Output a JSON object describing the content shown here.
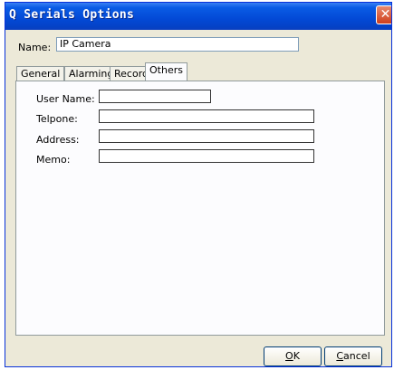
{
  "window": {
    "title": "Q Serials Options",
    "close_glyph": "✕"
  },
  "name_field": {
    "label": "Name:",
    "value": "IP Camera"
  },
  "tabs": [
    {
      "label": "General",
      "active": false
    },
    {
      "label": "Alarming",
      "active": false
    },
    {
      "label": "Record",
      "active": false
    },
    {
      "label": "Others",
      "active": true
    }
  ],
  "others_tab": {
    "fields": [
      {
        "label": "User Name:",
        "value": ""
      },
      {
        "label": "Telpone:",
        "value": ""
      },
      {
        "label": "Address:",
        "value": ""
      },
      {
        "label": "Memo:",
        "value": ""
      }
    ]
  },
  "buttons": {
    "ok": {
      "mnemonic": "O",
      "rest": "K"
    },
    "cancel": {
      "mnemonic": "C",
      "rest": "ancel"
    }
  },
  "colors": {
    "titlebar": "#0349d6",
    "dialog_bg": "#ece9d8",
    "close_button": "#cf3f1c"
  }
}
